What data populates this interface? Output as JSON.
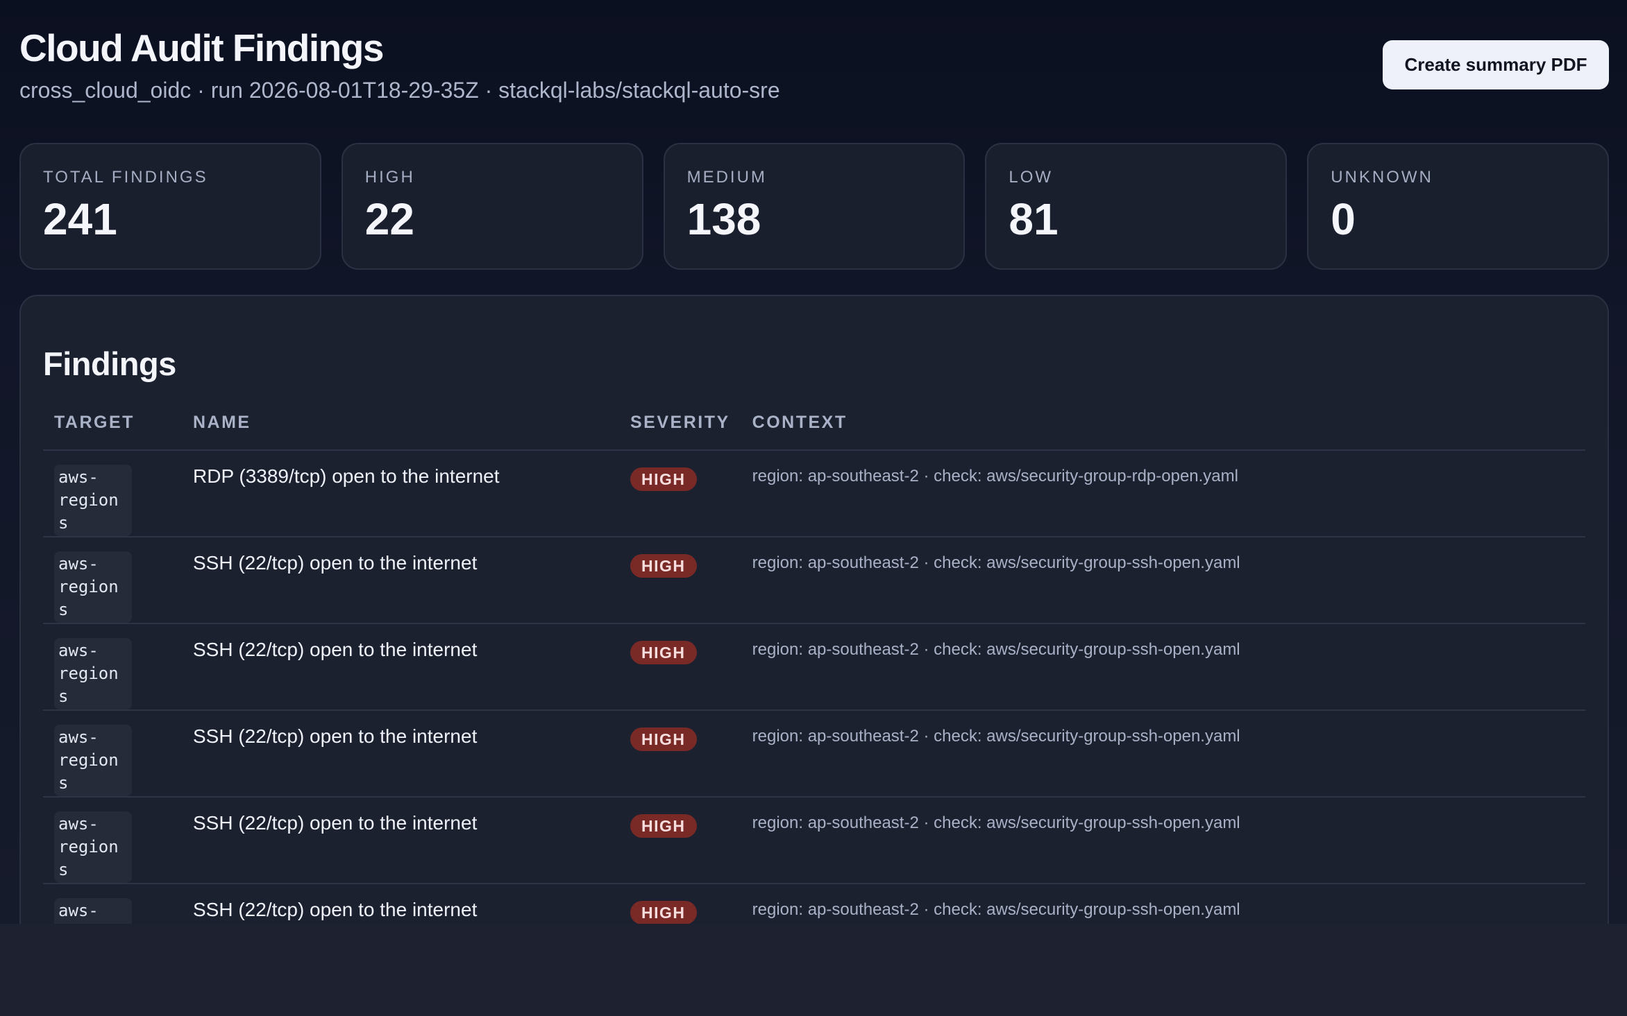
{
  "header": {
    "title": "Cloud Audit Findings",
    "subtitle": "cross_cloud_oidc · run 2026-08-01T18-29-35Z · stackql-labs/stackql-auto-sre",
    "pdf_button_label": "Create summary PDF"
  },
  "stats": [
    {
      "label": "TOTAL FINDINGS",
      "value": "241"
    },
    {
      "label": "HIGH",
      "value": "22"
    },
    {
      "label": "MEDIUM",
      "value": "138"
    },
    {
      "label": "LOW",
      "value": "81"
    },
    {
      "label": "UNKNOWN",
      "value": "0"
    }
  ],
  "findings": {
    "title": "Findings",
    "columns": [
      "TARGET",
      "NAME",
      "SEVERITY",
      "CONTEXT"
    ],
    "rows": [
      {
        "target": "aws-regions",
        "name": "RDP (3389/tcp) open to the internet",
        "severity": "HIGH",
        "context": "region: ap-southeast-2 · check: aws/security-group-rdp-open.yaml"
      },
      {
        "target": "aws-regions",
        "name": "SSH (22/tcp) open to the internet",
        "severity": "HIGH",
        "context": "region: ap-southeast-2 · check: aws/security-group-ssh-open.yaml"
      },
      {
        "target": "aws-regions",
        "name": "SSH (22/tcp) open to the internet",
        "severity": "HIGH",
        "context": "region: ap-southeast-2 · check: aws/security-group-ssh-open.yaml"
      },
      {
        "target": "aws-regions",
        "name": "SSH (22/tcp) open to the internet",
        "severity": "HIGH",
        "context": "region: ap-southeast-2 · check: aws/security-group-ssh-open.yaml"
      },
      {
        "target": "aws-regions",
        "name": "SSH (22/tcp) open to the internet",
        "severity": "HIGH",
        "context": "region: ap-southeast-2 · check: aws/security-group-ssh-open.yaml"
      },
      {
        "target": "aws-regions",
        "name": "SSH (22/tcp) open to the internet",
        "severity": "HIGH",
        "context": "region: ap-southeast-2 · check: aws/security-group-ssh-open.yaml"
      }
    ]
  },
  "colors": {
    "background": "#0b1020",
    "card": "#1a1f2e",
    "high_badge": "#7a2a26",
    "button": "#eef1fa"
  }
}
